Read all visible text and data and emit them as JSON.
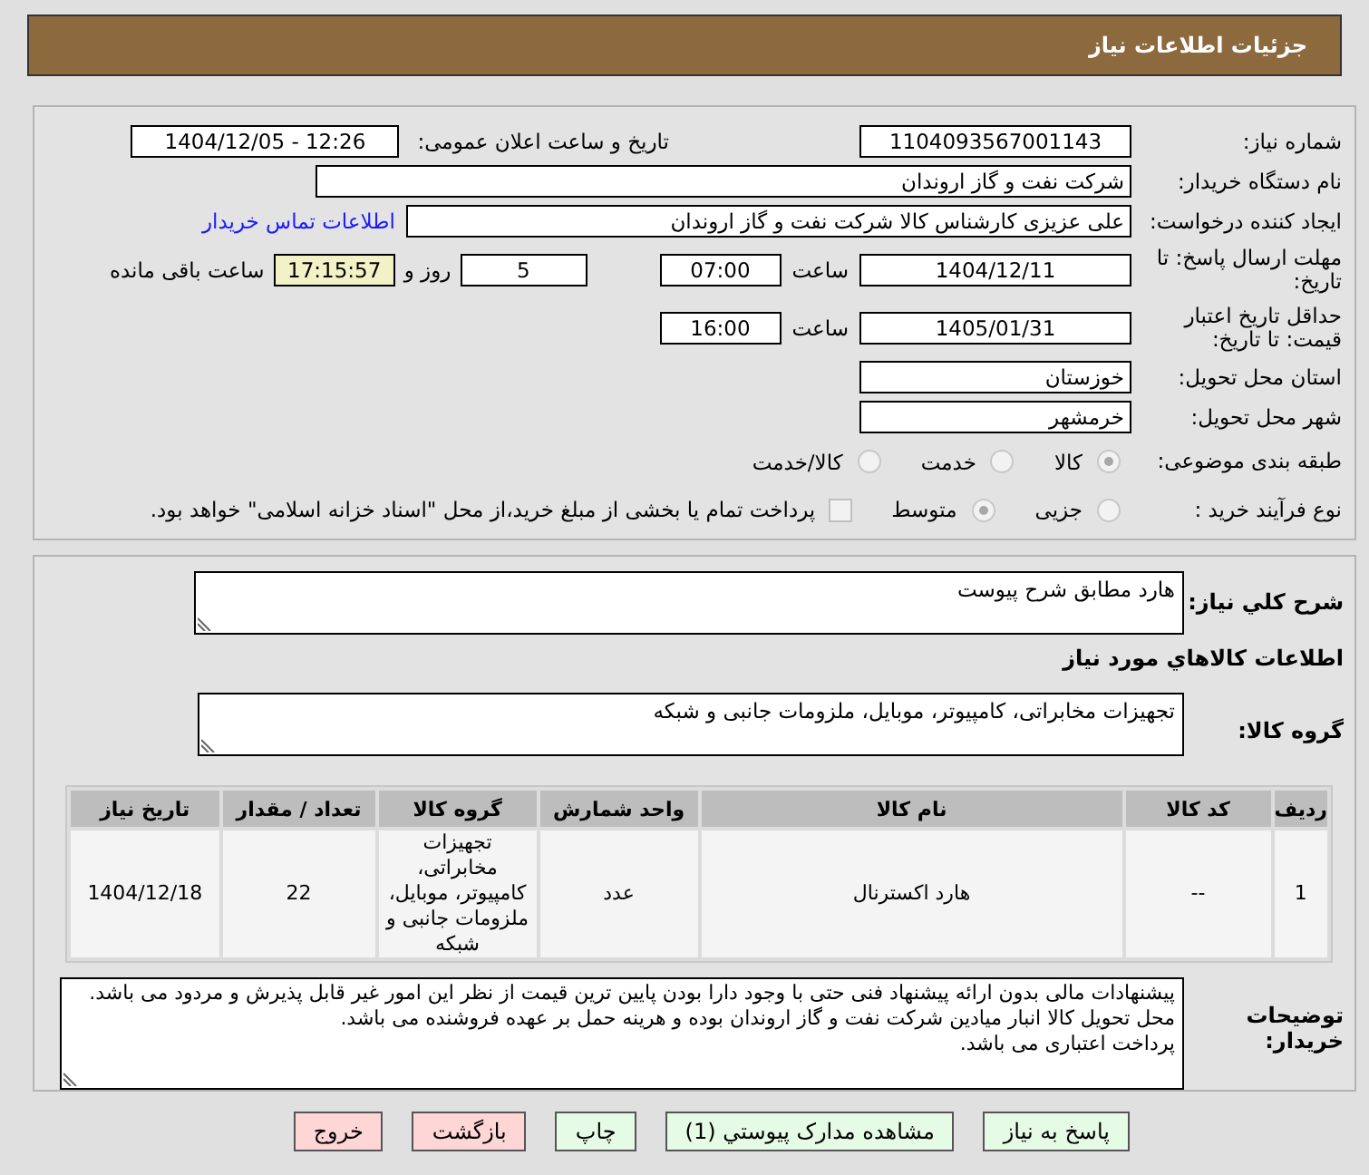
{
  "header": {
    "title": "جزئیات اطلاعات نیاز"
  },
  "info": {
    "need_number": {
      "label": "شماره نیاز:",
      "value": "1104093567001143"
    },
    "announce": {
      "label": "تاریخ و ساعت اعلان عمومی:",
      "value": "1404/12/05 - 12:26"
    },
    "buyer": {
      "label": "نام دستگاه خریدار:",
      "value": "شرکت نفت و گاز اروندان"
    },
    "creator": {
      "label": "ایجاد کننده درخواست:",
      "value": "علی عزیزی کارشناس کالا شرکت نفت و گاز اروندان",
      "link": "اطلاعات تماس خریدار"
    },
    "deadline": {
      "label": "مهلت ارسال پاسخ: تا تاریخ:",
      "date": "1404/12/11",
      "time_label": "ساعت",
      "time": "07:00",
      "days": "5",
      "days_label": "روز و",
      "remaining": "17:15:57",
      "remaining_label": "ساعت باقی مانده"
    },
    "validity": {
      "label": "حداقل تاریخ اعتبار قیمت: تا تاریخ:",
      "date": "1405/01/31",
      "time_label": "ساعت",
      "time": "16:00"
    },
    "province": {
      "label": "استان محل تحویل:",
      "value": "خوزستان"
    },
    "city": {
      "label": "شهر محل تحویل:",
      "value": "خرمشهر"
    },
    "category": {
      "label": "طبقه بندی موضوعی:",
      "options": [
        {
          "label": "کالا",
          "selected": true
        },
        {
          "label": "خدمت",
          "selected": false
        },
        {
          "label": "کالا/خدمت",
          "selected": false
        }
      ]
    },
    "process": {
      "label": "نوع فرآیند خرید :",
      "options": [
        {
          "label": "جزیی",
          "selected": false
        },
        {
          "label": "متوسط",
          "selected": true
        }
      ],
      "payment": {
        "checked": false,
        "text": "پرداخت تمام یا بخشی از مبلغ خرید،از محل \"اسناد خزانه اسلامی\" خواهد بود."
      }
    }
  },
  "details": {
    "description": {
      "label": "شرح کلي نیاز:",
      "value": "هارد مطابق شرح پیوست"
    },
    "goods_title": "اطلاعات کالاهاي مورد نیاز",
    "group": {
      "label": "گروه کالا:",
      "value": "تجهیزات مخابراتی، کامپیوتر، موبایل، ملزومات جانبی و شبکه"
    },
    "table": {
      "columns": [
        "ردیف",
        "کد کالا",
        "نام کالا",
        "واحد شمارش",
        "گروه کالا",
        "تعداد / مقدار",
        "تاریخ نیاز"
      ],
      "rows": [
        [
          "1",
          "--",
          "هارد اکسترنال",
          "عدد",
          "تجهیزات مخابراتی، کامپیوتر، موبایل، ملزومات جانبی و شبکه",
          "22",
          "1404/12/18"
        ]
      ]
    },
    "notes": {
      "label": "توضیحات خریدار:",
      "value": "پیشنهادات مالی بدون ارائه پیشنهاد فنی حتی با وجود دارا بودن پایین ترین قیمت از نظر این امور غیر قابل پذیرش و مردود می باشد.\nمحل تحویل کالا انبار میادین شرکت نفت و گاز اروندان بوده و هرینه حمل بر عهده فروشنده می باشد.\nپرداخت اعتباری می باشد."
    }
  },
  "buttons": [
    {
      "label": "پاسخ به نیاز",
      "kind": "primary"
    },
    {
      "label": "مشاهده مدارک پیوستي (1)",
      "kind": "primary"
    },
    {
      "label": "چاپ",
      "kind": "primary"
    },
    {
      "label": "بازگشت",
      "kind": "danger"
    },
    {
      "label": "خروج",
      "kind": "danger"
    }
  ]
}
